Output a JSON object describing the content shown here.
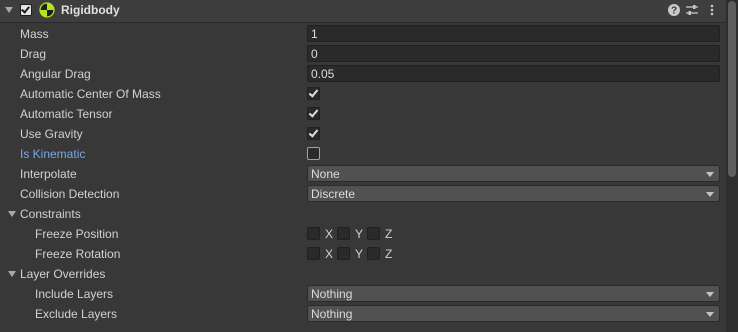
{
  "header": {
    "title": "Rigidbody",
    "icons": [
      "help-icon",
      "presets-icon",
      "menu-icon"
    ]
  },
  "fields": {
    "mass": {
      "label": "Mass",
      "value": "1"
    },
    "drag": {
      "label": "Drag",
      "value": "0"
    },
    "angular_drag": {
      "label": "Angular Drag",
      "value": "0.05"
    },
    "auto_com": {
      "label": "Automatic Center Of Mass",
      "checked": true
    },
    "auto_tensor": {
      "label": "Automatic Tensor",
      "checked": true
    },
    "use_gravity": {
      "label": "Use Gravity",
      "checked": true
    },
    "is_kinematic": {
      "label": "Is Kinematic",
      "checked": false
    },
    "interpolate": {
      "label": "Interpolate",
      "value": "None"
    },
    "collision": {
      "label": "Collision Detection",
      "value": "Discrete"
    }
  },
  "constraints": {
    "label": "Constraints",
    "freeze_position": {
      "label": "Freeze Position",
      "axes": [
        "X",
        "Y",
        "Z"
      ]
    },
    "freeze_rotation": {
      "label": "Freeze Rotation",
      "axes": [
        "X",
        "Y",
        "Z"
      ]
    }
  },
  "layer_overrides": {
    "label": "Layer Overrides",
    "include": {
      "label": "Include Layers",
      "value": "Nothing"
    },
    "exclude": {
      "label": "Exclude Layers",
      "value": "Nothing"
    }
  },
  "colors": {
    "background": "#383838",
    "header": "#3e3e3e",
    "field": "#2a2a2a",
    "dropdown": "#515151",
    "accent_blue": "#7aa7e6"
  }
}
